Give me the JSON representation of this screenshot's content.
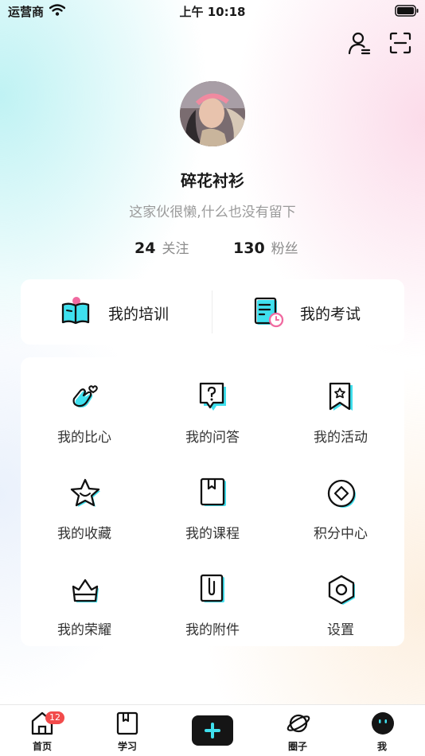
{
  "status_bar": {
    "carrier": "运营商",
    "time": "上午 10:18"
  },
  "header": {
    "icons": [
      "user-list-icon",
      "scan-icon"
    ]
  },
  "profile": {
    "nickname": "碎花衬衫",
    "bio": "这家伙很懒,什么也没有留下",
    "following_count": "24",
    "following_label": "关注",
    "fans_count": "130",
    "fans_label": "粉丝"
  },
  "quick_actions": [
    {
      "label": "我的培训",
      "icon": "training-book-icon"
    },
    {
      "label": "我的考试",
      "icon": "exam-clock-icon"
    }
  ],
  "menu_grid": [
    {
      "label": "我的比心",
      "icon": "finger-heart-icon"
    },
    {
      "label": "我的问答",
      "icon": "question-bubble-icon"
    },
    {
      "label": "我的活动",
      "icon": "activity-flag-icon"
    },
    {
      "label": "我的收藏",
      "icon": "star-icon"
    },
    {
      "label": "我的课程",
      "icon": "course-book-icon"
    },
    {
      "label": "积分中心",
      "icon": "points-diamond-icon"
    },
    {
      "label": "我的荣耀",
      "icon": "honor-basket-icon"
    },
    {
      "label": "我的附件",
      "icon": "attachment-icon"
    },
    {
      "label": "设置",
      "icon": "settings-hexagon-icon"
    }
  ],
  "tab_bar": {
    "items": [
      {
        "label": "首页",
        "icon": "home-icon",
        "badge": "12"
      },
      {
        "label": "学习",
        "icon": "study-book-icon"
      },
      {
        "label": "",
        "icon": "add-plus-icon"
      },
      {
        "label": "圈子",
        "icon": "planet-icon"
      },
      {
        "label": "我",
        "icon": "me-face-icon",
        "active": true
      }
    ]
  },
  "colors": {
    "accent": "#3fe0ee",
    "pink_accent": "#f06aa0",
    "badge": "#f24b4b",
    "text": "#1a1a1a",
    "muted": "#9a9a9a"
  }
}
